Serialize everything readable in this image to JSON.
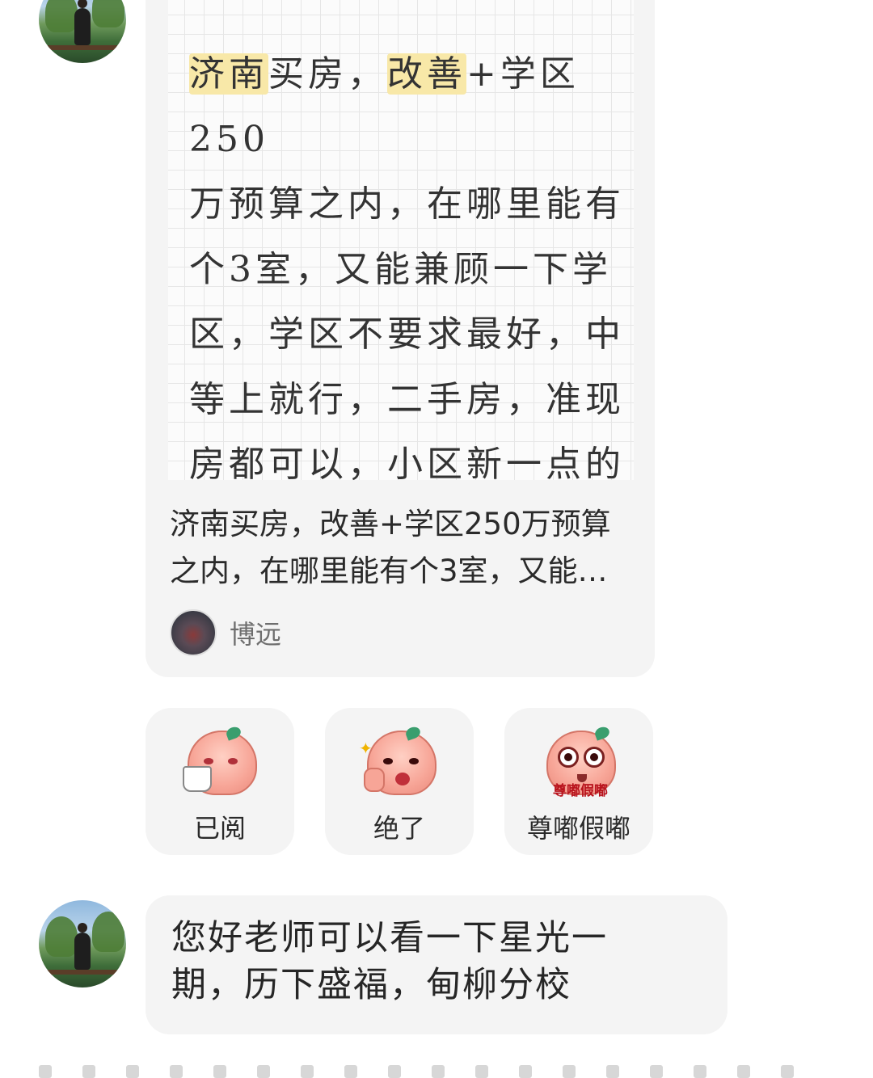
{
  "post_card": {
    "note_lines": [
      {
        "hl1": "济南",
        "t1": "买房，",
        "hl2": "改善",
        "t2": "+学区250"
      },
      {
        "text": "万预算之内，在哪里能有"
      },
      {
        "text": "个3室，又能兼顾一下学"
      },
      {
        "text": "区，学区不要求最好，中"
      },
      {
        "text": "等上就行，二手房，准现"
      },
      {
        "text": "房都可以，小区新一点的"
      }
    ],
    "title": "济南买房，改善+学区250万预算之内，在哪里能有个3室，又能兼顾一下学区，学区不要求最好，中等上就行，二手房，准现房都可以，小区新一点的",
    "author": "博远"
  },
  "stickers": [
    {
      "label": "已阅",
      "icon": "sipping-tea-peach-icon"
    },
    {
      "label": "绝了",
      "icon": "thumbs-up-peach-icon"
    },
    {
      "label": "尊嘟假嘟",
      "icon": "wide-eyed-peach-icon",
      "inner_caption": "尊嘟假嘟"
    }
  ],
  "message": {
    "text": "您好老师可以看一下星光一期，历下盛福，甸柳分校"
  }
}
